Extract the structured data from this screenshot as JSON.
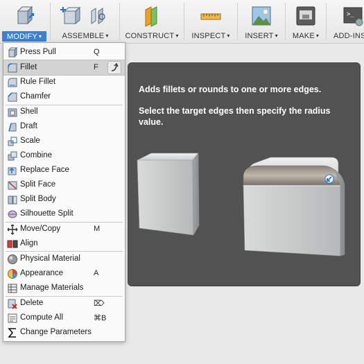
{
  "toolbar": {
    "groups": [
      {
        "label": "MODIFY",
        "active": true
      },
      {
        "label": "ASSEMBLE"
      },
      {
        "label": "CONSTRUCT"
      },
      {
        "label": "INSPECT"
      },
      {
        "label": "INSERT"
      },
      {
        "label": "MAKE"
      },
      {
        "label": "ADD-INS"
      }
    ],
    "caret": "▾"
  },
  "menu": {
    "items": [
      {
        "label": "Press Pull",
        "shortcut": "Q",
        "icon": "press-pull-icon"
      },
      {
        "label": "Fillet",
        "shortcut": "F",
        "icon": "fillet-icon",
        "highlighted": true
      },
      {
        "label": "Rule Fillet",
        "icon": "rule-fillet-icon"
      },
      {
        "label": "Chamfer",
        "icon": "chamfer-icon"
      },
      {
        "label": "Shell",
        "icon": "shell-icon"
      },
      {
        "label": "Draft",
        "icon": "draft-icon"
      },
      {
        "label": "Scale",
        "icon": "scale-icon"
      },
      {
        "label": "Combine",
        "icon": "combine-icon"
      },
      {
        "label": "Replace Face",
        "icon": "replace-face-icon"
      },
      {
        "label": "Split Face",
        "icon": "split-face-icon"
      },
      {
        "label": "Split Body",
        "icon": "split-body-icon"
      },
      {
        "label": "Silhouette Split",
        "icon": "silhouette-split-icon"
      },
      {
        "label": "Move/Copy",
        "shortcut": "M",
        "icon": "move-copy-icon"
      },
      {
        "label": "Align",
        "icon": "align-icon"
      },
      {
        "label": "Physical Material",
        "icon": "physical-material-icon"
      },
      {
        "label": "Appearance",
        "shortcut": "A",
        "icon": "appearance-icon"
      },
      {
        "label": "Manage Materials",
        "icon": "manage-materials-icon"
      },
      {
        "label": "Delete",
        "shortcut": "⌦",
        "icon": "delete-icon"
      },
      {
        "label": "Compute All",
        "shortcut": "⌘B",
        "icon": "compute-all-icon"
      },
      {
        "label": "Change Parameters",
        "icon": "change-parameters-icon"
      }
    ]
  },
  "tooltip": {
    "line1": "Adds fillets or rounds to one or more edges.",
    "line2": "Select the target edges then specify the radius value."
  },
  "colors": {
    "accent": "#3d7fd1",
    "tooltip_bg": "#525252",
    "menu_bg": "#fafafa"
  }
}
